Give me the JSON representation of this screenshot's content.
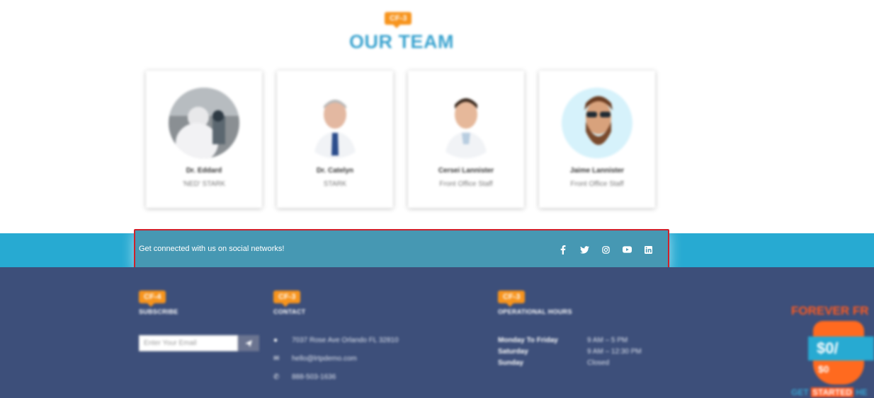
{
  "team": {
    "badge": "CF-3",
    "title": "OUR TEAM",
    "members": [
      {
        "name": "Dr. Eddard",
        "role": "'NED' STARK"
      },
      {
        "name": "Dr. Catelyn",
        "role": "STARK"
      },
      {
        "name": "Cersei Lannister",
        "role": "Front Office Staff"
      },
      {
        "name": "Jaime Lannister",
        "role": "Front Office Staff"
      }
    ]
  },
  "social": {
    "text": "Get connected with us on social networks!",
    "icons": [
      "facebook-icon",
      "twitter-icon",
      "instagram-icon",
      "youtube-icon",
      "linkedin-icon"
    ],
    "highlight_color": "#d0202a"
  },
  "footer": {
    "subscribe": {
      "badge": "CF-4",
      "title": "SUBSCRIBE",
      "placeholder": "Enter Your Email"
    },
    "contact": {
      "badge": "CF-3",
      "title": "CONTACT",
      "address": "7037 Rose Ave Orlando FL 32810",
      "email": "hello@lrtpdemo.com",
      "phone": "888-503-1636"
    },
    "hours": {
      "badge": "CF-3",
      "title": "OPERATIONAL HOURS",
      "rows": [
        {
          "day": "Monday To Friday",
          "time": "9 AM – 5 PM"
        },
        {
          "day": "Saturday",
          "time": "9 AM – 12:30 PM"
        },
        {
          "day": "Sunday",
          "time": "Closed"
        }
      ]
    },
    "promo": {
      "title": "FOREVER FR",
      "price": "$0/",
      "small": "$0",
      "cta_start": "GET ",
      "cta_highlight": "STARTED",
      "cta_end": " HE"
    }
  },
  "colors": {
    "accent": "#27aad2",
    "footer": "#3d4f7a",
    "orange": "#f7941d",
    "title": "#3aa3cf"
  }
}
